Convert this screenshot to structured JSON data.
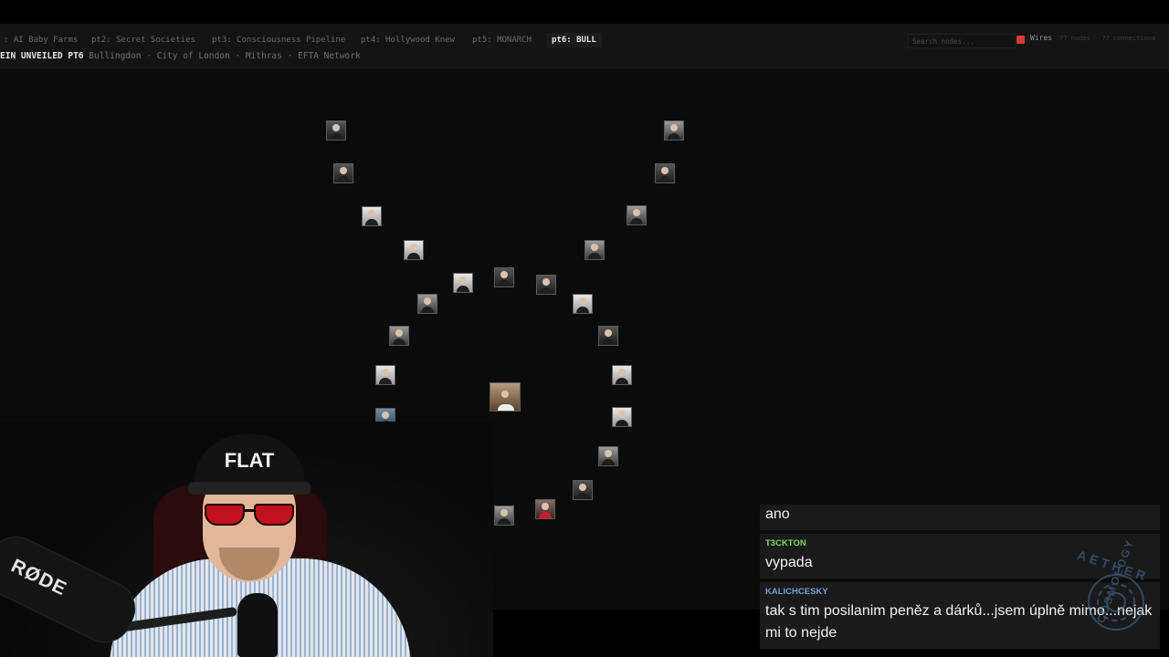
{
  "tabs": [
    {
      "label": ": AI Baby Farms",
      "active": false
    },
    {
      "label": "pt2: Secret Societies",
      "active": false
    },
    {
      "label": "pt3: Consciousness Pipeline",
      "active": false
    },
    {
      "label": "pt4: Hollywood Knew",
      "active": false
    },
    {
      "label": "pt5: MONARCH",
      "active": false
    },
    {
      "label": "pt6: BULL",
      "active": true
    }
  ],
  "header": {
    "title": "EIN UNVEILED PT6",
    "subtitle": "Bullingdon · City of London · Mithras · EFTA Network"
  },
  "toolbar": {
    "search_placeholder": "Search nodes...",
    "wires_label": "Wires",
    "wires_checked": true,
    "counts_text": "?? nodes · ?? connections"
  },
  "graph": {
    "node_count": 33
  },
  "webcam": {
    "cap_text": "FLAT",
    "mic_brand": "RØDE"
  },
  "chat": {
    "messages": [
      {
        "user": "",
        "text": "ano",
        "user_color": "#ffffff"
      },
      {
        "user": "T3CKTON",
        "text": "vypada",
        "user_color": "#7ad85a"
      },
      {
        "user": "KALICHCESKY",
        "text": "tak s tim posilanim peněz a dárků...jsem úplně mimo...nejak mi to nejde",
        "user_color": "#6ea0d8"
      }
    ]
  },
  "watermark": {
    "top": "AETHER",
    "bottom": "COSMOLOGY"
  },
  "colors": {
    "accent": "#d33a3a",
    "background": "#0b0b0b",
    "tabbar": "#141414"
  }
}
